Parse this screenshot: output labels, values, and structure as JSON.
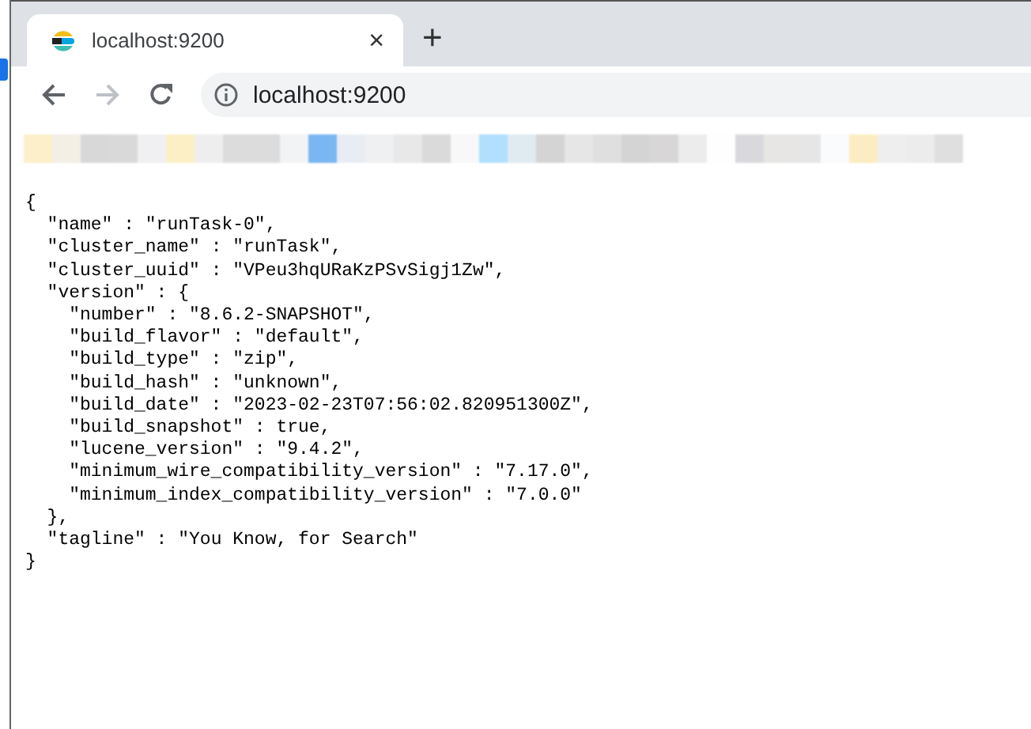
{
  "tab": {
    "title": "localhost:9200",
    "close": "×",
    "new_tab": "+",
    "selected": true
  },
  "address_bar": {
    "url": "localhost:9200"
  },
  "document": {
    "lines": [
      {
        "text": "{",
        "children": [
          {
            "text": "\"name\" : \"runTask-0\","
          },
          {
            "text": "\"cluster_name\" : \"runTask\","
          },
          {
            "text": "\"cluster_uuid\" : \"VPeu3hqURaKzPSvSigj1Zw\","
          },
          {
            "text": "\"version\" : {",
            "children": [
              {
                "text": "\"number\" : \"8.6.2-SNAPSHOT\","
              },
              {
                "text": "\"build_flavor\" : \"default\","
              },
              {
                "text": "\"build_type\" : \"zip\","
              },
              {
                "text": "\"build_hash\" : \"unknown\","
              },
              {
                "text": "\"build_date\" : \"2023-02-23T07:56:02.820951300Z\","
              },
              {
                "text": "\"build_snapshot\" : true,"
              },
              {
                "text": "\"lucene_version\" : \"9.4.2\","
              },
              {
                "text": "\"minimum_wire_compatibility_version\" : \"7.17.0\","
              },
              {
                "text": "\"minimum_index_compatibility_version\" : \"7.0.0\""
              }
            ]
          },
          {
            "text": "},"
          },
          {
            "text": "\"tagline\" : \"You Know, for Search\""
          }
        ]
      },
      {
        "text": "}"
      }
    ]
  }
}
